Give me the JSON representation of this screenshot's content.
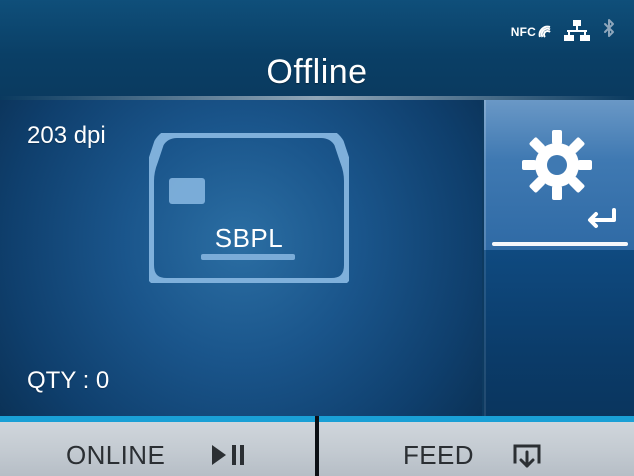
{
  "header": {
    "title": "Offline",
    "status": {
      "nfc_label": "NFC",
      "icons": [
        "nfc-icon",
        "lan-icon",
        "bluetooth-icon"
      ]
    }
  },
  "left_panel": {
    "dpi": "203 dpi",
    "emulation": "SBPL",
    "qty": "QTY : 0"
  },
  "settings": {
    "icons": [
      "gear-icon",
      "enter-icon"
    ]
  },
  "buttons": {
    "online": {
      "label": "ONLINE",
      "icon": "play-pause-icon"
    },
    "feed": {
      "label": "FEED",
      "icon": "feed-icon"
    }
  },
  "colors": {
    "header_bg": "#0a3f66",
    "panel_bg": "#1a558b",
    "settings_bg": "#3f79b2",
    "button_bg": "#c3cad1",
    "button_accent": "#1aa0d6",
    "text_light": "#ffffff",
    "text_dark": "#2b2f33"
  }
}
